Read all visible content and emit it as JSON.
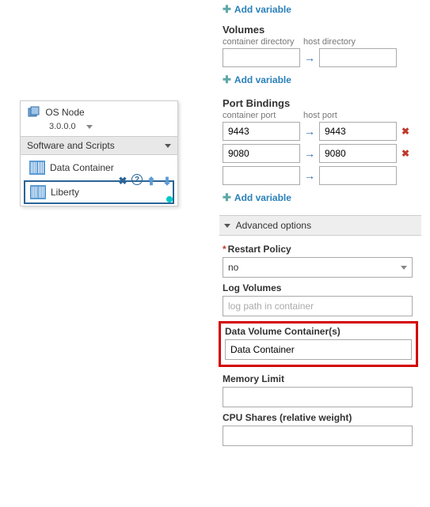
{
  "leftPanel": {
    "osNode": {
      "title": "OS Node",
      "version": "3.0.0.0"
    },
    "softwareHeader": "Software and Scripts",
    "items": [
      {
        "label": "Data Container"
      },
      {
        "label": "Liberty"
      }
    ]
  },
  "addVariable": "Add variable",
  "volumes": {
    "title": "Volumes",
    "label1": "container directory",
    "label2": "host directory",
    "rows": [
      {
        "a": "",
        "b": ""
      }
    ]
  },
  "ports": {
    "title": "Port Bindings",
    "label1": "container port",
    "label2": "host port",
    "rows": [
      {
        "a": "9443",
        "b": "9443",
        "del": true
      },
      {
        "a": "9080",
        "b": "9080",
        "del": true
      },
      {
        "a": "",
        "b": "",
        "del": false
      }
    ]
  },
  "advHeader": "Advanced options",
  "restart": {
    "label": "Restart Policy",
    "value": "no"
  },
  "logVolumes": {
    "label": "Log Volumes",
    "placeholder": "log path in container"
  },
  "dataVolContainers": {
    "label": "Data Volume Container(s)",
    "value": "Data Container"
  },
  "memoryLimit": {
    "label": "Memory Limit"
  },
  "cpuShares": {
    "label": "CPU Shares (relative weight)"
  }
}
